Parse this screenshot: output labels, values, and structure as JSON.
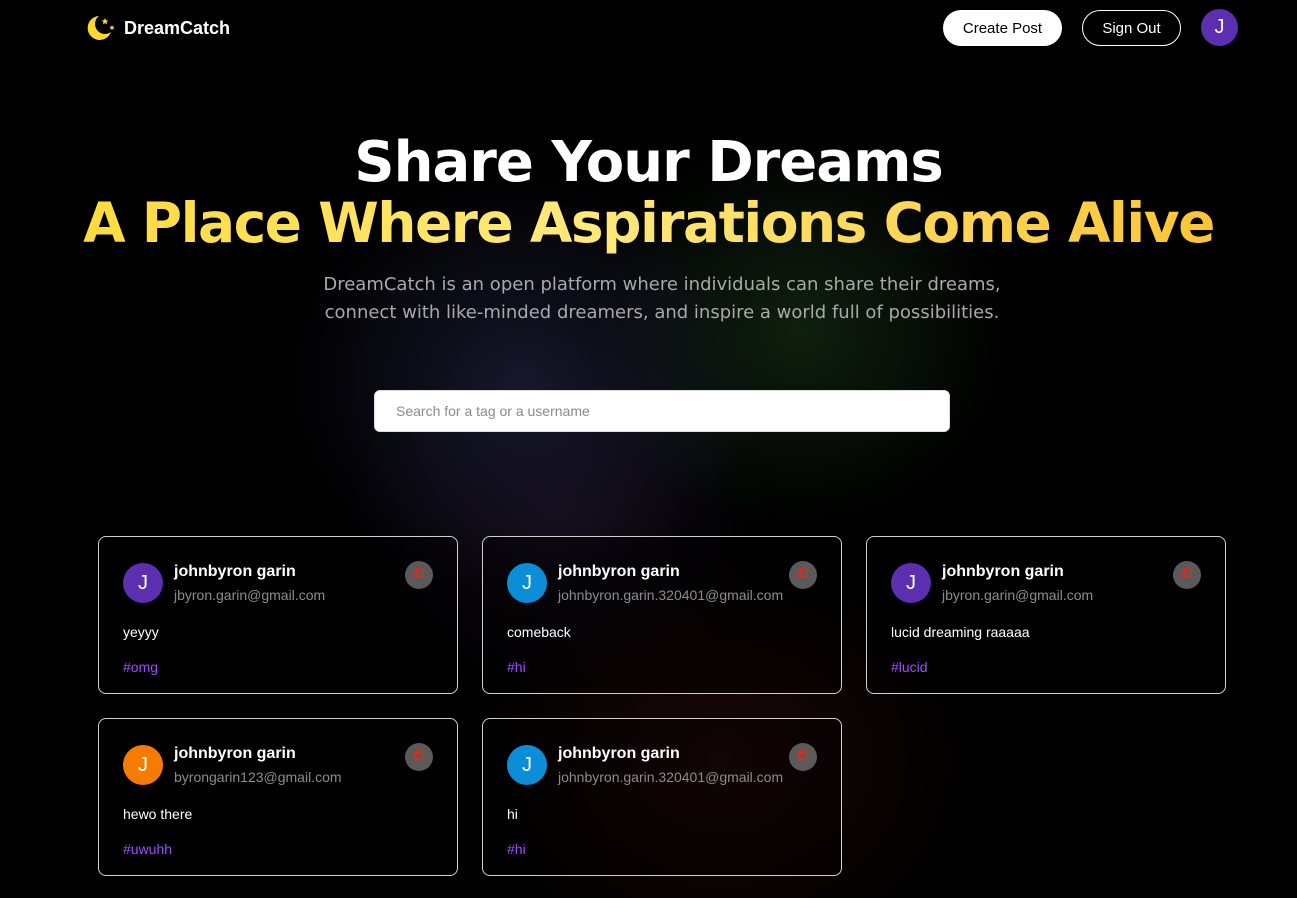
{
  "brand": {
    "name": "DreamCatch",
    "icon": "moon-stars-icon",
    "icon_color": "#fdd835"
  },
  "nav": {
    "create_post_label": "Create Post",
    "sign_out_label": "Sign Out",
    "avatar_initial": "J",
    "avatar_color": "#5b2fb0"
  },
  "hero": {
    "title": "Share Your Dreams",
    "subtitle": "A Place Where Aspirations Come Alive",
    "description_line1": "DreamCatch is an open platform where individuals can share their dreams,",
    "description_line2": "connect with like-minded dreamers, and inspire a world full of possibilities."
  },
  "search": {
    "placeholder": "Search for a tag or a username",
    "value": ""
  },
  "posts": [
    {
      "initial": "J",
      "avatar_color": "#5b2fb0",
      "name": "johnbyron garin",
      "email": "jbyron.garin@gmail.com",
      "text": "yeyyy",
      "tag": "#omg",
      "copy_icon": "copy-icon"
    },
    {
      "initial": "J",
      "avatar_color": "#0b8dd8",
      "name": "johnbyron garin",
      "email": "johnbyron.garin.320401@gmail.com",
      "text": "comeback",
      "tag": "#hi",
      "copy_icon": "copy-icon"
    },
    {
      "initial": "J",
      "avatar_color": "#5b2fb0",
      "name": "johnbyron garin",
      "email": "jbyron.garin@gmail.com",
      "text": "lucid dreaming raaaaa",
      "tag": "#lucid",
      "copy_icon": "copy-icon"
    },
    {
      "initial": "J",
      "avatar_color": "#f57c00",
      "name": "johnbyron garin",
      "email": "byrongarin123@gmail.com",
      "text": "hewo there",
      "tag": "#uwuhh",
      "copy_icon": "copy-icon"
    },
    {
      "initial": "J",
      "avatar_color": "#0b8dd8",
      "name": "johnbyron garin",
      "email": "johnbyron.garin.320401@gmail.com",
      "text": "hi",
      "tag": "#hi",
      "copy_icon": "copy-icon"
    }
  ],
  "colors": {
    "accent_yellow": "#fdd835",
    "tag_purple": "#9c4dff",
    "card_border": "#d0d0d0"
  }
}
